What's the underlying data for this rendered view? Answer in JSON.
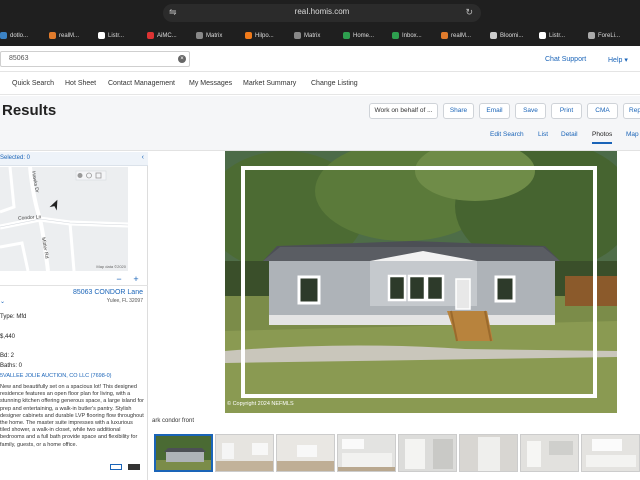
{
  "browser": {
    "url": "reaI.homis.com",
    "bookmarks": [
      {
        "label": "dotlo...",
        "color": "#3b82c4"
      },
      {
        "label": "realM...",
        "color": "#e07b2c"
      },
      {
        "label": "Listr...",
        "color": "#ffffff"
      },
      {
        "label": "AiMC...",
        "color": "#d33"
      },
      {
        "label": "Matrix",
        "color": "#888"
      },
      {
        "label": "Hilpo...",
        "color": "#f07a1a"
      },
      {
        "label": "Matrix",
        "color": "#888"
      },
      {
        "label": "Home...",
        "color": "#2e9f4f"
      },
      {
        "label": "Inbox...",
        "color": "#2e9f4f"
      },
      {
        "label": "realM...",
        "color": "#e07b2c"
      },
      {
        "label": "Bloomi...",
        "color": "#ccc"
      },
      {
        "label": "Listr...",
        "color": "#ffffff"
      },
      {
        "label": "ForeLi...",
        "color": "#aaa"
      }
    ]
  },
  "header": {
    "search_value": "85063",
    "chat_support": "Chat Support",
    "help": "Help ▾"
  },
  "menu": [
    "Quick Search",
    "Hot Sheet",
    "Contact Management",
    "My Messages",
    "Market Summary",
    "Change Listing"
  ],
  "results": {
    "title": "Results",
    "work_on_behalf": "Work on behalf of ...",
    "actions": [
      "Share",
      "Email",
      "Save",
      "Print",
      "CMA",
      "Rep"
    ],
    "view_tabs": [
      "Edit Search",
      "List",
      "Detail",
      "Photos",
      "Map"
    ],
    "active_tab": "Photos"
  },
  "left_panel": {
    "header": "Selected: 0",
    "collapse": "‹",
    "map_roads": [
      "Condor Ln",
      "Hawks Dr",
      "Mittler Rd"
    ],
    "map_credit": "Map data ©2020",
    "zoom_out": "−",
    "zoom_in": "+",
    "address": "85063 CONDOR Lane",
    "city": "Yulee, FL 32097",
    "facts": [
      "Type: Mfd",
      "$,440",
      "Bd: 2",
      "Baths: 0"
    ],
    "office": "5VALLEE JOLIE AUCTION, CO LLC (7698-0)",
    "description": "New and beautifully set on a spacious lot! This designed residence features an open floor plan for living, with a stunning kitchen offering generous space, a large island for prep and entertaining, a walk-in butler's pantry. Stylish designer cabinets and durable LVP flooring flow throughout the home. The master suite impresses with a luxurious tiled shower, a walk-in closet, while two additional bedrooms and a full bath provide space and flexibility for family, guests, or a home office."
  },
  "photo": {
    "watermark": "© Copyright 2024 NEFMLS",
    "caption": "ark condor front",
    "thumb_count": 9
  }
}
